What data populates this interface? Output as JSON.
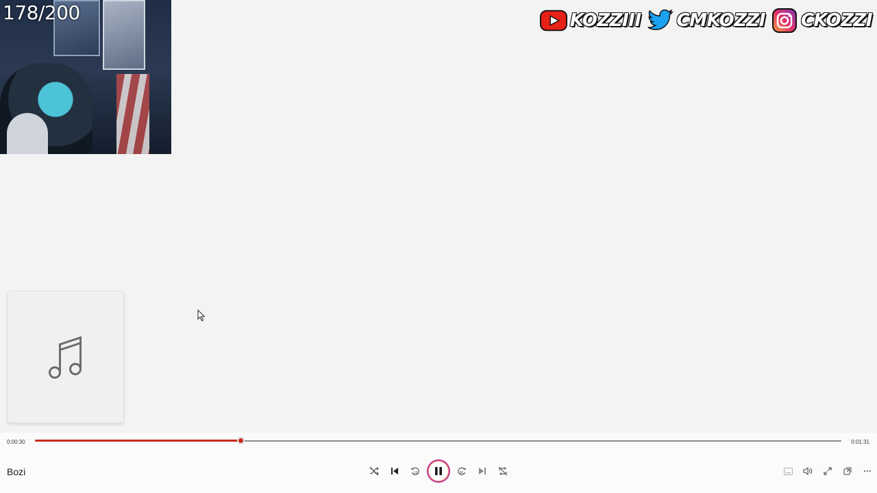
{
  "overlay": {
    "counter": "178/200",
    "socials": [
      {
        "icon": "youtube-icon",
        "handle": "KOZZIII",
        "color": "#e62117"
      },
      {
        "icon": "twitter-icon",
        "handle": "CMKOZZI",
        "color": "#1da1f2"
      },
      {
        "icon": "instagram-icon",
        "handle": "CKOZZI",
        "color": "#c13584"
      }
    ]
  },
  "player": {
    "current_time": "0:00:30",
    "duration": "0:01:31",
    "progress_fraction": 0.2545,
    "track_title": "Bozi",
    "accent_color": "#c42b1c",
    "controls": [
      "shuffle-icon",
      "previous-icon",
      "rewind-10-icon",
      "pause-icon",
      "forward-30-icon",
      "next-icon",
      "repeat-icon"
    ],
    "right_controls": [
      "subtitles-icon",
      "volume-icon",
      "fullscreen-icon",
      "mini-player-icon",
      "more-icon"
    ]
  }
}
